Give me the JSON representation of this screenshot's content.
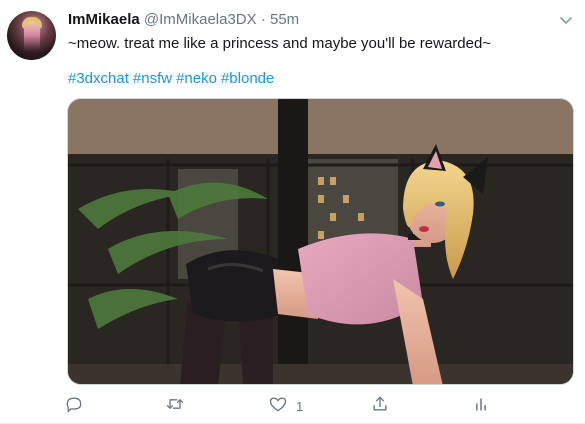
{
  "tweet": {
    "display_name": "ImMikaela",
    "handle": "@ImMikaela3DX",
    "separator": "·",
    "time": "55m",
    "text": "~meow. treat me like a princess and maybe you'll be rewarded~",
    "hashtags": [
      "#3dxchat",
      "#nsfw",
      "#neko",
      "#blonde"
    ],
    "media_icon": "photo",
    "actions": {
      "reply_icon": "reply-icon",
      "retweet_icon": "retweet-icon",
      "like_icon": "like-icon",
      "like_count": "1",
      "share_icon": "share-icon",
      "analytics_icon": "analytics-icon"
    },
    "colors": {
      "link": "#1b95e0",
      "secondary_text": "#657786",
      "primary_text": "#14171a"
    }
  }
}
